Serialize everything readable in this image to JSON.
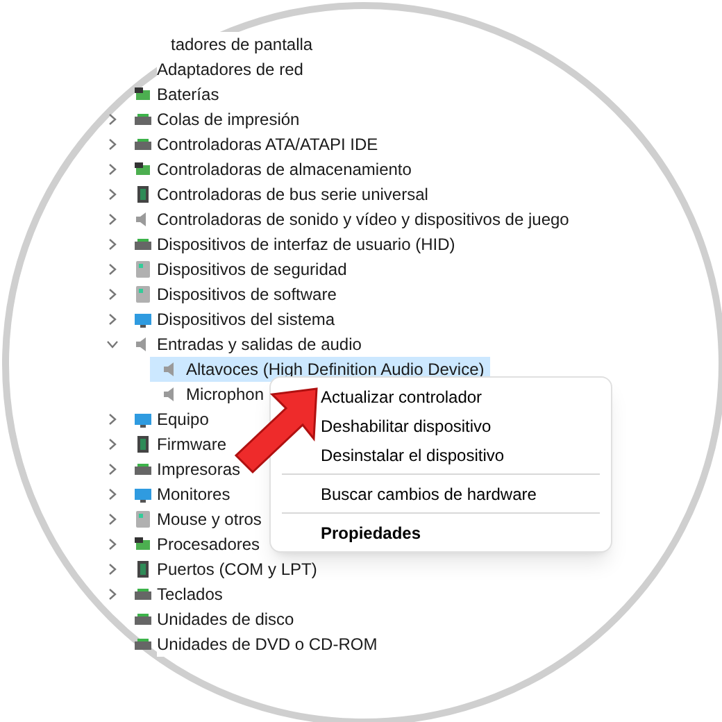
{
  "tree": [
    {
      "label": "tadores de pantalla"
    },
    {
      "label": "Adaptadores de red"
    },
    {
      "label": "Baterías"
    },
    {
      "label": "Colas de impresión",
      "expanded": false
    },
    {
      "label": "Controladoras ATA/ATAPI IDE",
      "expanded": false
    },
    {
      "label": "Controladoras de almacenamiento",
      "expanded": false
    },
    {
      "label": "Controladoras de bus serie universal",
      "expanded": false
    },
    {
      "label": "Controladoras de sonido y vídeo y dispositivos de juego",
      "expanded": false
    },
    {
      "label": "Dispositivos de interfaz de usuario (HID)",
      "expanded": false
    },
    {
      "label": "Dispositivos de seguridad",
      "expanded": false
    },
    {
      "label": "Dispositivos de software",
      "expanded": false
    },
    {
      "label": "Dispositivos del sistema",
      "expanded": false
    },
    {
      "label": "Entradas y salidas de audio",
      "expanded": true,
      "children": [
        {
          "label": "Altavoces (High Definition Audio Device)",
          "selected": true
        },
        {
          "label": "Microphon",
          "selected": false
        }
      ]
    },
    {
      "label": "Equipo",
      "expanded": false
    },
    {
      "label": "Firmware",
      "expanded": false
    },
    {
      "label": "Impresoras",
      "expanded": false
    },
    {
      "label": "Monitores",
      "expanded": false
    },
    {
      "label": "Mouse y otros",
      "expanded": false
    },
    {
      "label": "Procesadores",
      "expanded": false
    },
    {
      "label": "Puertos (COM y LPT)",
      "expanded": false
    },
    {
      "label": "Teclados",
      "expanded": false
    },
    {
      "label": "Unidades de disco"
    },
    {
      "label": "Unidades de DVD o CD-ROM"
    }
  ],
  "context_menu": {
    "items": [
      {
        "label": "Actualizar controlador",
        "kind": "item"
      },
      {
        "label": "Deshabilitar dispositivo",
        "kind": "item"
      },
      {
        "label": "Desinstalar el dispositivo",
        "kind": "item"
      },
      {
        "kind": "separator"
      },
      {
        "label": "Buscar cambios de hardware",
        "kind": "item"
      },
      {
        "kind": "separator"
      },
      {
        "label": "Propiedades",
        "kind": "default"
      }
    ]
  }
}
